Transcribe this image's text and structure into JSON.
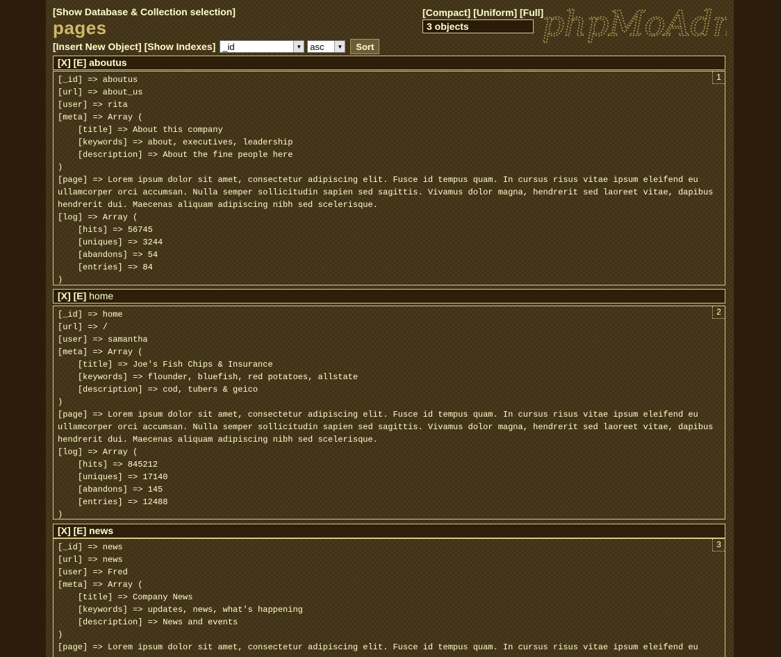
{
  "header": {
    "db_selection_link": "[Show Database & Collection selection]",
    "collection_name": "pages",
    "insert_link": "[Insert New Object]",
    "indexes_link": "[Show Indexes]",
    "sort_field_value": "_id",
    "sort_order_value": "asc",
    "sort_button": "Sort",
    "view_compact": "[Compact]",
    "view_uniform": "[Uniform]",
    "view_full": "[Full]",
    "object_count": "3 objects",
    "logo_text": "phpMoAdmin"
  },
  "documents": [
    {
      "delete_link": "[X]",
      "edit_link": "[E]",
      "id_label": "aboutus",
      "index": "1",
      "content": "[_id] => aboutus\n[url] => about_us\n[user] => rita\n[meta] => Array (\n    [title] => About this company\n    [keywords] => about, executives, leadership\n    [description] => About the fine people here\n)\n[page] => Lorem ipsum dolor sit amet, consectetur adipiscing elit. Fusce id tempus quam. In cursus risus vitae ipsum eleifend eu\nullamcorper orci accumsan. Nulla semper sollicitudin sapien sed sagittis. Vivamus dolor magna, hendrerit sed laoreet vitae, dapibus\nhendrerit dui. Maecenas aliquam adipiscing nibh sed scelerisque.\n[log] => Array (\n    [hits] => 56745\n    [uniques] => 3244\n    [abandons] => 54\n    [entries] => 84\n)"
    },
    {
      "delete_link": "[X]",
      "edit_link": "[E]",
      "id_label": "home",
      "index": "2",
      "content": "[_id] => home\n[url] => /\n[user] => samantha\n[meta] => Array (\n    [title] => Joe's Fish Chips & Insurance\n    [keywords] => flounder, bluefish, red potatoes, allstate\n    [description] => cod, tubers & geico\n)\n[page] => Lorem ipsum dolor sit amet, consectetur adipiscing elit. Fusce id tempus quam. In cursus risus vitae ipsum eleifend eu\nullamcorper orci accumsan. Nulla semper sollicitudin sapien sed sagittis. Vivamus dolor magna, hendrerit sed laoreet vitae, dapibus\nhendrerit dui. Maecenas aliquam adipiscing nibh sed scelerisque.\n[log] => Array (\n    [hits] => 845212\n    [uniques] => 17140\n    [abandons] => 145\n    [entries] => 12488\n)"
    },
    {
      "delete_link": "[X]",
      "edit_link": "[E]",
      "id_label": "news",
      "index": "3",
      "content": "[_id] => news\n[url] => news\n[user] => Fred\n[meta] => Array (\n    [title] => Company News\n    [keywords] => updates, news, what's happening\n    [description] => News and events\n)\n[page] => Lorem ipsum dolor sit amet, consectetur adipiscing elit. Fusce id tempus quam. In cursus risus vitae ipsum eleifend eu"
    }
  ]
}
